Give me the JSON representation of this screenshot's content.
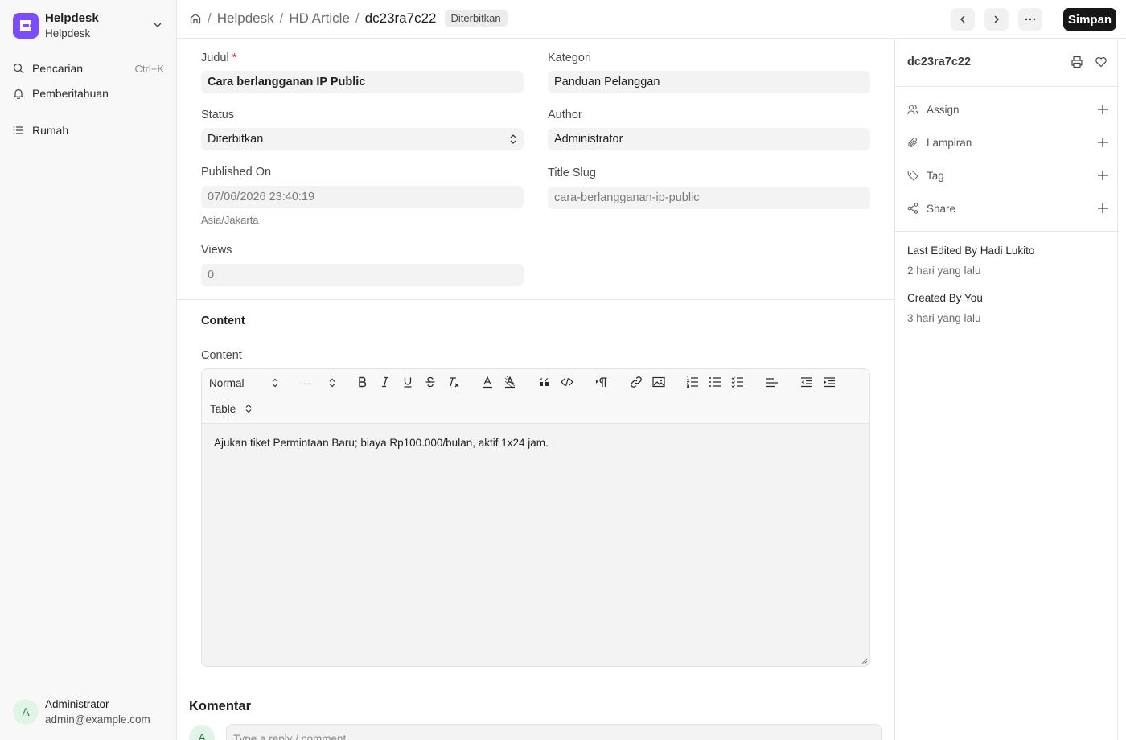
{
  "sidebar": {
    "brand_title": "Helpdesk",
    "brand_subtitle": "Helpdesk",
    "search_label": "Pencarian",
    "search_shortcut": "Ctrl+K",
    "notifications_label": "Pemberitahuan",
    "home_label": "Rumah",
    "user_initial": "A",
    "user_name": "Administrator",
    "user_email": "admin@example.com",
    "brand_color": "#7c4dff"
  },
  "header": {
    "crumb_1": "Helpdesk",
    "crumb_2": "HD Article",
    "crumb_3": "dc23ra7c22",
    "status_badge": "Diterbitkan",
    "save_label": "Simpan"
  },
  "form": {
    "title_label": "Judul",
    "title_required": "*",
    "title_value": "Cara berlangganan IP Public",
    "category_label": "Kategori",
    "category_value": "Panduan Pelanggan",
    "status_label": "Status",
    "status_value": "Diterbitkan",
    "author_label": "Author",
    "author_value": "Administrator",
    "published_label": "Published On",
    "published_value": "07/06/2026 23:40:19",
    "timezone": "Asia/Jakarta",
    "slug_label": "Title Slug",
    "slug_value": "cara-berlangganan-ip-public",
    "views_label": "Views",
    "views_value": "0"
  },
  "content": {
    "section_title": "Content",
    "field_label": "Content",
    "format_select": "Normal",
    "size_select": "---",
    "table_select": "Table",
    "body_text": "Ajukan tiket Permintaan Baru; biaya Rp100.000/bulan, aktif 1x24 jam."
  },
  "comments": {
    "title": "Komentar",
    "avatar_initial": "A",
    "placeholder": "Type a reply / comment"
  },
  "right_panel": {
    "doc_id": "dc23ra7c22",
    "assign_label": "Assign",
    "attachments_label": "Lampiran",
    "tag_label": "Tag",
    "share_label": "Share",
    "last_edited": "Last Edited By Hadi Lukito",
    "last_edited_time": "2 hari yang lalu",
    "created": "Created By You",
    "created_time": "3 hari yang lalu"
  }
}
